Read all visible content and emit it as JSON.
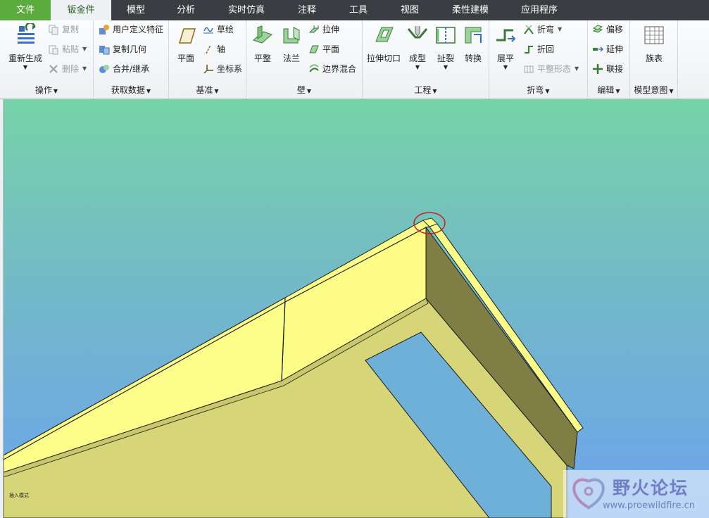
{
  "tabs": [
    {
      "label": "文件"
    },
    {
      "label": "钣金件"
    },
    {
      "label": "模型"
    },
    {
      "label": "分析"
    },
    {
      "label": "实时仿真"
    },
    {
      "label": "注释"
    },
    {
      "label": "工具"
    },
    {
      "label": "视图"
    },
    {
      "label": "柔性建模"
    },
    {
      "label": "应用程序"
    }
  ],
  "groups": {
    "operations": {
      "label": "操作",
      "regenerate": "重新生成",
      "copy": "复制",
      "paste": "粘贴",
      "delete": "删除"
    },
    "get_data": {
      "label": "获取数据",
      "udf": "用户定义特征",
      "copy_geom": "复制几何",
      "merge": "合并/继承"
    },
    "datum": {
      "label": "基准",
      "plane": "平面",
      "sketch": "草绘",
      "axis": "轴",
      "csys": "坐标系"
    },
    "wall": {
      "label": "壁",
      "flat": "平整",
      "flange": "法兰",
      "extrude": "拉伸",
      "planar": "平面",
      "blend": "边界混合"
    },
    "engineering": {
      "label": "工程",
      "extrude_cut": "拉伸切口",
      "form": "成型",
      "rip": "扯裂",
      "convert": "转换"
    },
    "bend": {
      "label": "折弯",
      "unbend": "展平",
      "bend": "折弯",
      "bend_back": "折回",
      "flat_state": "平整形态"
    },
    "edit": {
      "label": "编辑",
      "offset": "偏移",
      "extend": "延伸",
      "join": "联接"
    },
    "model_intent": {
      "label": "模型意图",
      "family_table": "族表"
    }
  },
  "viewport": {
    "mode_text": "插入模式"
  },
  "watermark": {
    "title": "野火论坛",
    "url": "www.proewildfire.cn"
  },
  "colors": {
    "tab_bar": "#3a3d42",
    "file_tab": "#5aac3c",
    "active_tab": "#2b5e22",
    "sheet_light": "#fdfd8a",
    "sheet_mid": "#d6d578",
    "sheet_dark": "#7f7e44",
    "highlight_circle": "#d21d1d"
  }
}
